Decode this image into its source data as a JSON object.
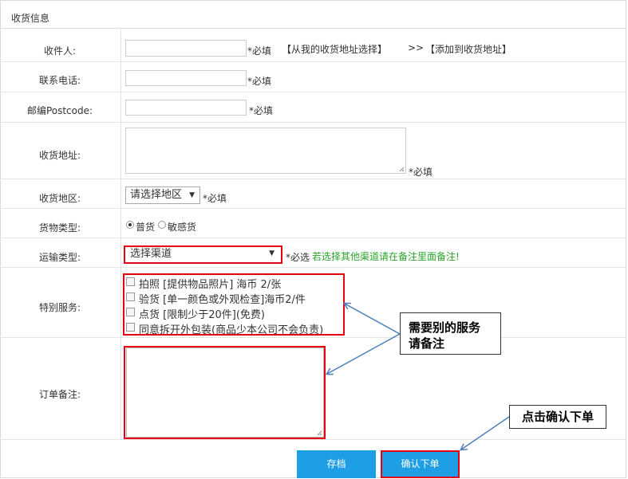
{
  "section_title": "收货信息",
  "fields": {
    "recipient": {
      "label": "收件人:",
      "required": "*必填",
      "pick_from_book": "【从我的收货地址选择】",
      "arrow": ">>",
      "add_to_book": "【添加到收货地址】"
    },
    "phone": {
      "label": "联系电话:",
      "required": "*必填"
    },
    "postcode": {
      "label": "邮编Postcode:",
      "required": "*必填"
    },
    "address": {
      "label": "收货地址:",
      "required": "*必填"
    },
    "region": {
      "label": "收货地区:",
      "selected": "请选择地区",
      "required": "*必填"
    },
    "cargo_type": {
      "label": "货物类型:",
      "options": [
        "普货",
        "敏感货"
      ],
      "selected_index": 0
    },
    "shipping": {
      "label": "运输类型:",
      "selected": "选择渠道",
      "required": "*必选",
      "hint": "若选择其他渠道请在备注里面备注!"
    },
    "special": {
      "label": "特别服务:",
      "options": [
        "拍照 [提供物品照片] 海币 2/张",
        "验货 [单一颜色或外观检查]海币2/件",
        "点货 [限制少于20件](免费)",
        "同意拆开外包装(商品少本公司不会负责)"
      ]
    },
    "remark": {
      "label": "订单备注:"
    }
  },
  "buttons": {
    "save": "存档",
    "confirm": "确认下单"
  },
  "callouts": {
    "service_note": "需要别的服务\n请备注",
    "confirm_note": "点击确认下单"
  },
  "colors": {
    "accent_blue": "#1e9ee5",
    "highlight_red": "#e60012",
    "hint_green": "#2aa52a",
    "arrow_blue": "#4a7ebb"
  }
}
